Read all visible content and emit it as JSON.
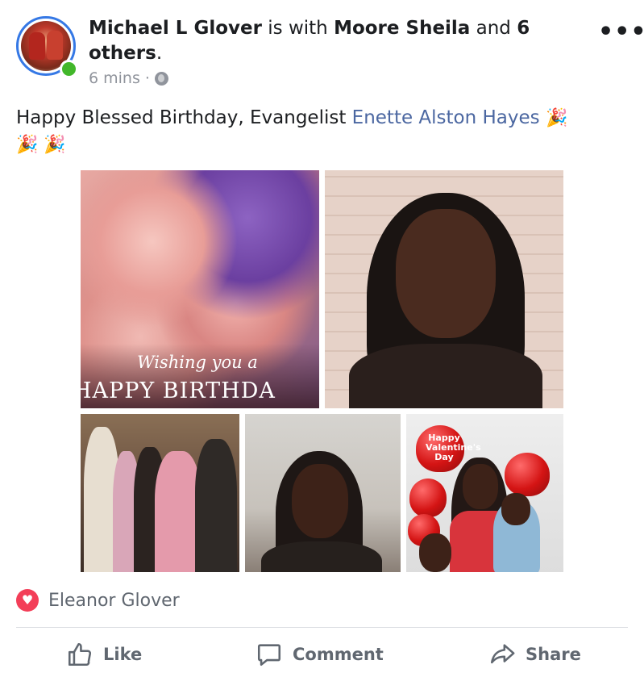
{
  "post": {
    "author": "Michael L Glover",
    "with_text": " is with ",
    "tagged": "Moore Sheila",
    "and_text": " and ",
    "others": "6 others",
    "period": ".",
    "time": "6 mins",
    "separator": "·",
    "text_prefix": "Happy Blessed Birthday, Evangelist ",
    "mention": "Enette Alston Hayes",
    "emojis_line1": "🎉",
    "emojis_line2": "🎉 🎉",
    "more_icon": "•••"
  },
  "photos": {
    "birthday_card_line1": "Wishing you a",
    "birthday_card_line2": "HAPPY BIRTHDA",
    "balloon_sign": "Happy Valentine's Day"
  },
  "reactions": {
    "icon": "heart-icon",
    "name": "Eleanor Glover"
  },
  "actions": {
    "like": "Like",
    "comment": "Comment",
    "share": "Share"
  },
  "colors": {
    "accent": "#3578e5",
    "mention": "#4b67a1",
    "online": "#42b72a",
    "love": "#f33e58",
    "muted": "#606770"
  }
}
